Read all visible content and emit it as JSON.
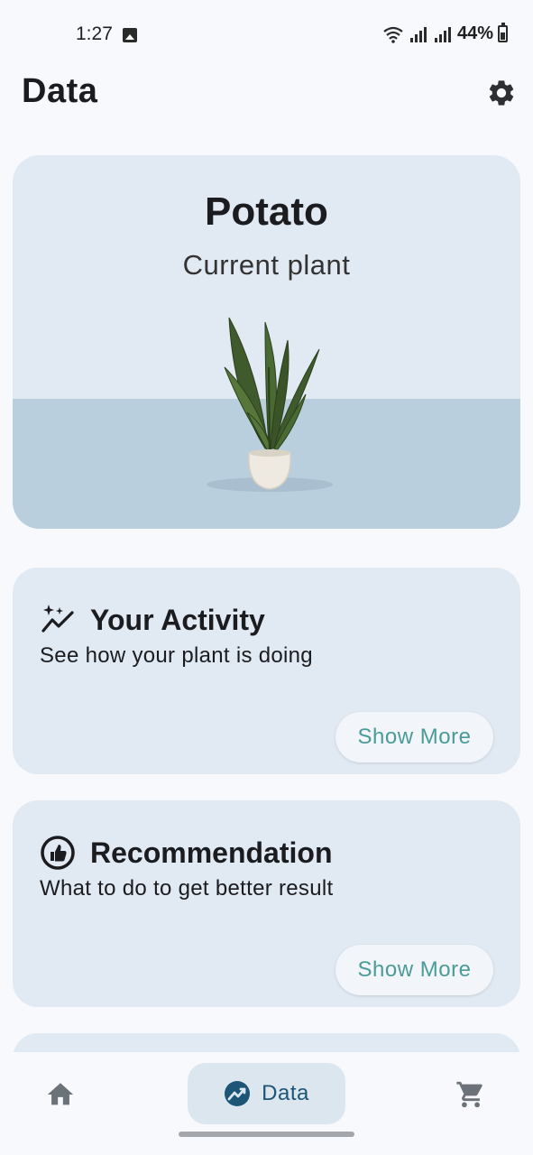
{
  "status_bar": {
    "time": "1:27",
    "battery": "44%"
  },
  "header": {
    "title": "Data",
    "settings_icon": "gear-icon"
  },
  "plant_card": {
    "name": "Potato",
    "subtitle": "Current plant"
  },
  "cards": {
    "activity": {
      "icon": "sparkle-trend-icon",
      "title": "Your Activity",
      "description": "See how your plant is doing",
      "button_label": "Show More"
    },
    "recommendation": {
      "icon": "thumb-up-icon",
      "title": "Recommendation",
      "description": "What to do to get better result",
      "button_label": "Show More"
    }
  },
  "bottom_nav": {
    "items": [
      {
        "icon": "home-icon",
        "label": ""
      },
      {
        "icon": "chart-icon",
        "label": "Data",
        "active": true
      },
      {
        "icon": "cart-icon",
        "label": ""
      }
    ]
  },
  "colors": {
    "card_bg": "#e1e9f2",
    "accent_text": "#4b9b97",
    "nav_active": "#1c5576"
  }
}
